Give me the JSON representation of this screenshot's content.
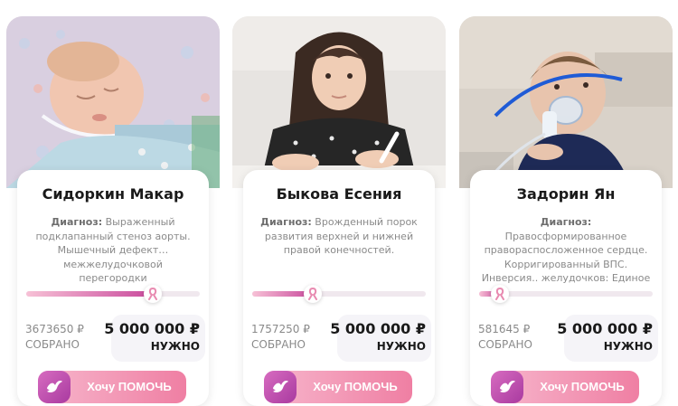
{
  "cards": [
    {
      "name": "Сидоркин Макар",
      "diagnosis_label": "Диагноз:",
      "diagnosis_text": " Выраженный подклапанный стеноз аорты. Мышечный дефект… межжелудочковой перегородки",
      "collected_amount": "3673650 ₽",
      "collected_label": "СОБРАНО",
      "need_amount": "5 000 000 ₽",
      "need_label": "НУЖНО",
      "progress_fraction": 0.73,
      "button_label": "Хочу ПОМОЧЬ"
    },
    {
      "name": "Быкова Есения",
      "diagnosis_label": "Диагноз:",
      "diagnosis_text": " Врожденный порок развития верхней и нижней правой конечностей.",
      "collected_amount": "1757250 ₽",
      "collected_label": "СОБРАНО",
      "need_amount": "5 000 000 ₽",
      "need_label": "НУЖНО",
      "progress_fraction": 0.35,
      "button_label": "Хочу ПОМОЧЬ"
    },
    {
      "name": "Задорин Ян",
      "diagnosis_label": "Диагноз:",
      "diagnosis_text": " Правосформированное правораспосложенное сердце. Корригированный ВПС. Инверсия.. желудочков: Единое",
      "collected_amount": "581645 ₽",
      "collected_label": "СОБРАНО",
      "need_amount": "5 000 000 ₽",
      "need_label": "НУЖНО",
      "progress_fraction": 0.12,
      "button_label": "Хочу ПОМОЧЬ"
    }
  ],
  "colors": {
    "progress_start": "#f7c1d6",
    "progress_end": "#c94a9c",
    "button_start": "#f7b6cc",
    "button_end": "#ef7fa3",
    "icon_bg": "#b63fa8"
  },
  "icons": {
    "ribbon": "awareness-ribbon-icon",
    "dove": "dove-icon"
  }
}
